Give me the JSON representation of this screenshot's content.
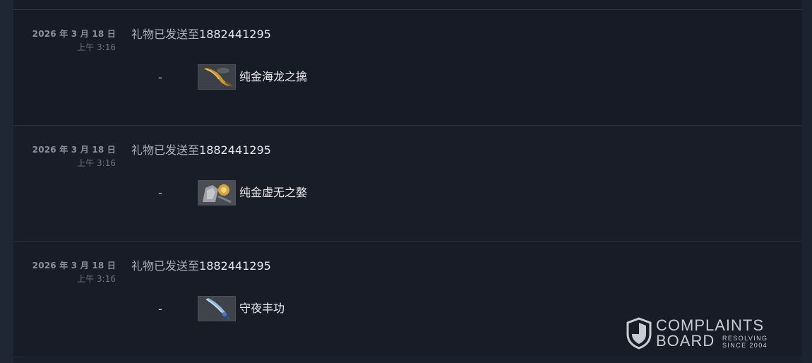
{
  "history": {
    "entries": [
      {
        "date": "2026 年 3 月 18 日",
        "time": "上午 3:16",
        "description": "礼物已发送至",
        "recipient": "1882441295",
        "change": "-",
        "item": {
          "name": "纯金海龙之擒",
          "icon": "golden-blade-icon"
        }
      },
      {
        "date": "2026 年 3 月 18 日",
        "time": "上午 3:16",
        "description": "礼物已发送至",
        "recipient": "1882441295",
        "change": "-",
        "item": {
          "name": "纯金虚无之嫯",
          "icon": "golden-armor-icon"
        }
      },
      {
        "date": "2026 年 3 月 18 日",
        "time": "上午 3:16",
        "description": "礼物已发送至",
        "recipient": "1882441295",
        "change": "-",
        "item": {
          "name": "守夜丰功",
          "icon": "frost-blade-icon"
        }
      }
    ]
  },
  "watermark": {
    "line1": "COMPLAINTS",
    "line2": "BOARD",
    "tag1": "RESOLVING",
    "tag2": "SINCE 2004",
    "icon": "shield-icon"
  },
  "colors": {
    "background": "#1b2230",
    "row": "#161b26",
    "text_primary": "#e4e8ee",
    "text_muted": "#8a919d"
  }
}
